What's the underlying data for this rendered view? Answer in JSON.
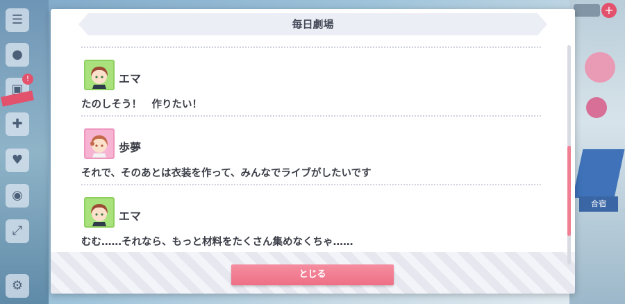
{
  "dialog": {
    "title": "毎日劇場",
    "close_label": "とじる"
  },
  "entries": [
    {
      "speaker": "エマ",
      "text": "たのしそう！　作りたい！",
      "avatar": "emma-avatar"
    },
    {
      "speaker": "歩夢",
      "text": "それで、そのあとは衣装を作って、みんなでライブがしたいです",
      "avatar": "ayumu-avatar"
    },
    {
      "speaker": "エマ",
      "text": "むむ……それなら、もっと材料をたくさん集めなくちゃ……",
      "avatar": "emma-avatar"
    }
  ],
  "background": {
    "right_label": "合宿"
  },
  "colors": {
    "accent": "#ee6f86",
    "emma_avatar_bg": "#a9e27d",
    "ayumu_avatar_bg": "#f6b3d2",
    "text": "#3a3d46"
  }
}
